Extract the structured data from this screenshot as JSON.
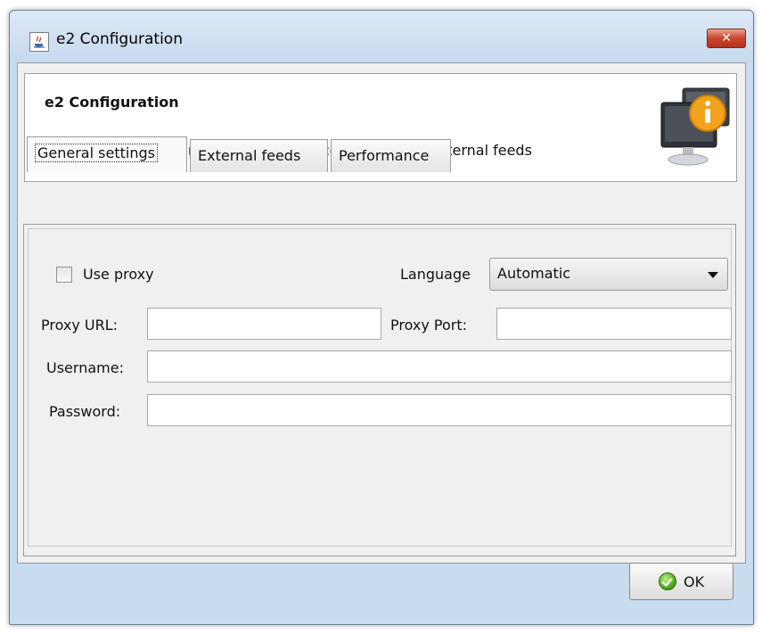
{
  "window": {
    "title": "e2 Configuration"
  },
  "header": {
    "title": "e2 Configuration",
    "description": "Here you can set general settings and configure your external feeds"
  },
  "tabs": [
    {
      "label": "General settings",
      "active": true
    },
    {
      "label": "External feeds",
      "active": false
    },
    {
      "label": "Performance",
      "active": false
    }
  ],
  "general": {
    "use_proxy_label": "Use proxy",
    "use_proxy_checked": false,
    "language_label": "Language",
    "language_value": "Automatic",
    "proxy_url_label": "Proxy URL:",
    "proxy_url_value": "",
    "proxy_port_label": "Proxy Port:",
    "proxy_port_value": "",
    "username_label": "Username:",
    "username_value": "",
    "password_label": "Password:",
    "password_value": ""
  },
  "footer": {
    "ok_label": "OK"
  },
  "icons": {
    "app": "java-icon",
    "close": "close-icon",
    "info": "info-monitor-icon",
    "ok": "checkmark-icon",
    "dropdown": "chevron-down-icon"
  }
}
